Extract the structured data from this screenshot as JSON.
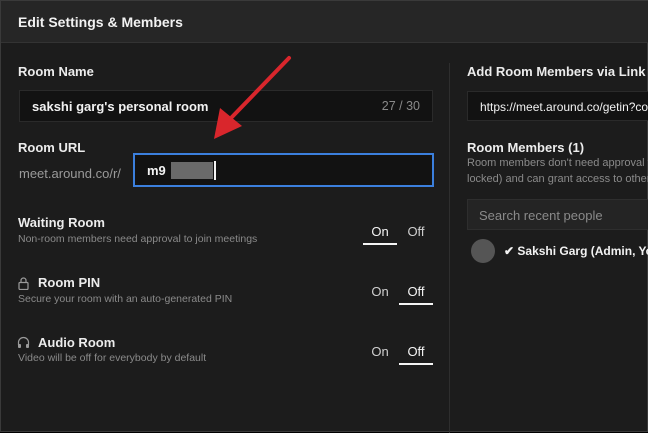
{
  "dialog": {
    "title": "Edit Settings & Members"
  },
  "room_name": {
    "label": "Room Name",
    "value": "sakshi garg's personal room",
    "count": "27 / 30"
  },
  "room_url": {
    "label": "Room URL",
    "prefix": "meet.around.co/r/",
    "value": "m9"
  },
  "waiting_room": {
    "label": "Waiting Room",
    "description": "Non-room members need approval to join meetings",
    "on_label": "On",
    "off_label": "Off",
    "selected": "On"
  },
  "room_pin": {
    "label": "Room PIN",
    "description": "Secure your room with an auto-generated PIN",
    "on_label": "On",
    "off_label": "Off",
    "selected": "Off",
    "icon": "lock-icon"
  },
  "audio_room": {
    "label": "Audio Room",
    "description": "Video will be off for everybody by default",
    "on_label": "On",
    "off_label": "Off",
    "selected": "Off",
    "icon": "headphones-icon"
  },
  "add_members": {
    "label": "Add Room Members via Link",
    "link": "https://meet.around.co/getin?co"
  },
  "room_members": {
    "label": "Room Members (1)",
    "desc_line1": "Room members don't need approval t",
    "desc_line2": "locked) and can grant access to other",
    "search_placeholder": "Search recent people",
    "members": [
      {
        "name": "✔ Sakshi Garg (Admin, You"
      }
    ]
  },
  "colors": {
    "focus_border": "#3b7fdd",
    "annotation_arrow": "#d9262c",
    "background": "#1c1c1c"
  }
}
